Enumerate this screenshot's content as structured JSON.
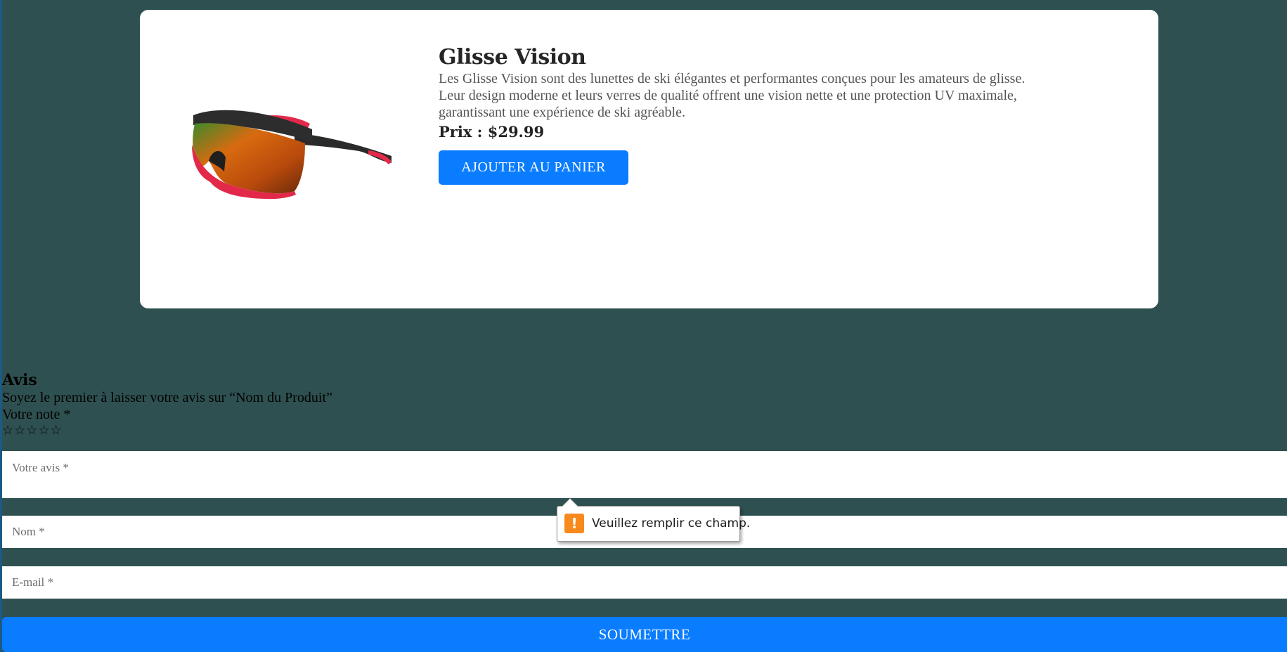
{
  "product": {
    "title": "Glisse Vision",
    "description_lines": [
      "Les Glisse Vision sont des lunettes de ski élégantes et performantes conçues pour les amateurs de glisse.",
      "Leur design moderne et leurs verres de qualité offrent une vision nette et une protection UV maximale,",
      "garantissant une expérience de ski agréable."
    ],
    "price": "Prix : $29.99",
    "add_to_cart_label": "AJOUTER AU PANIER",
    "image_icon": "ski-goggles-image"
  },
  "reviews": {
    "title": "Avis",
    "intro": "Soyez le premier à laisser votre avis sur “Nom du Produit”",
    "rating_label": "Votre note *",
    "stars": "☆☆☆☆☆",
    "star_count": 5,
    "rating_value": 0,
    "review_placeholder": "Votre avis *",
    "name_placeholder": "Nom *",
    "email_placeholder": "E-mail *",
    "submit_label": "SOUMETTRE"
  },
  "tooltip": {
    "icon": "warning-icon",
    "icon_glyph": "!",
    "message": "Veuillez remplir ce champ."
  },
  "colors": {
    "background": "#2f5050",
    "accent_button": "#0a7cff",
    "warning": "#f8891c"
  }
}
